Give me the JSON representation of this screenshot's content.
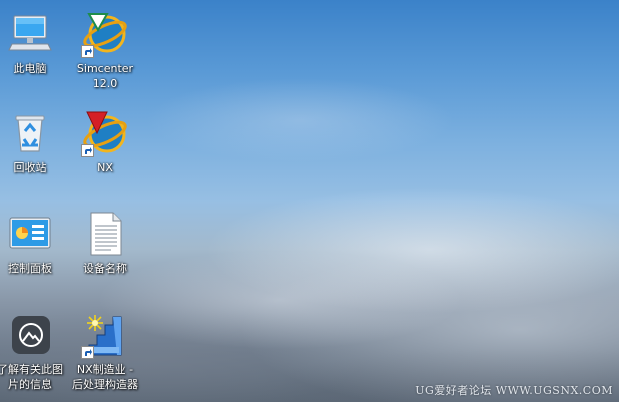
{
  "desktop": {
    "icons": [
      {
        "label_lines": [
          "此电脑"
        ],
        "icon": "computer-icon"
      },
      {
        "label_lines": [
          "Simcenter",
          "12.0"
        ],
        "icon": "simcenter-icon",
        "shortcut": true
      },
      {
        "label_lines": [
          "回收站"
        ],
        "icon": "recycle-bin-icon"
      },
      {
        "label_lines": [
          "NX"
        ],
        "icon": "nx-icon",
        "shortcut": true
      },
      {
        "label_lines": [
          "控制面板"
        ],
        "icon": "control-panel-icon"
      },
      {
        "label_lines": [
          "设备名称"
        ],
        "icon": "text-document-icon"
      },
      {
        "label_lines": [
          "了解有关此图",
          "片的信息"
        ],
        "icon": "spotlight-camera-icon"
      },
      {
        "label_lines": [
          "NX制造业 -",
          "后处理构造器"
        ],
        "icon": "post-builder-icon",
        "shortcut": true
      }
    ]
  },
  "watermark": {
    "text": "UG爱好者论坛 WWW.UGSNX.COM"
  },
  "colors": {
    "label_text": "#ffffff",
    "sky_top": "#3b82c9",
    "ground": "#5c6876"
  }
}
